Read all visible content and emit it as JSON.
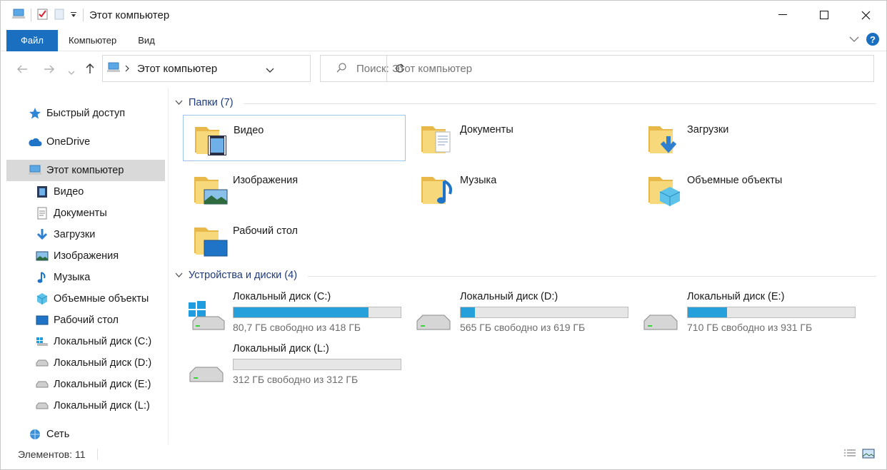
{
  "window": {
    "title": "Этот компьютер"
  },
  "ribbon": {
    "tabs": [
      "Файл",
      "Компьютер",
      "Вид"
    ]
  },
  "address": {
    "path": "Этот компьютер"
  },
  "search": {
    "placeholder": "Поиск: Этот компьютер"
  },
  "sidebar": {
    "items": [
      {
        "label": "Быстрый доступ",
        "icon": "star-icon"
      },
      {
        "label": "OneDrive",
        "icon": "cloud-icon"
      },
      {
        "label": "Этот компьютер",
        "icon": "computer-icon",
        "selected": true
      },
      {
        "label": "Видео",
        "icon": "video-icon"
      },
      {
        "label": "Документы",
        "icon": "document-icon"
      },
      {
        "label": "Загрузки",
        "icon": "download-icon"
      },
      {
        "label": "Изображения",
        "icon": "picture-icon"
      },
      {
        "label": "Музыка",
        "icon": "music-icon"
      },
      {
        "label": "Объемные объекты",
        "icon": "cube-icon"
      },
      {
        "label": "Рабочий стол",
        "icon": "desktop-icon"
      },
      {
        "label": "Локальный диск (C:)",
        "icon": "windows-drive-icon"
      },
      {
        "label": "Локальный диск (D:)",
        "icon": "drive-icon"
      },
      {
        "label": "Локальный диск (E:)",
        "icon": "drive-icon"
      },
      {
        "label": "Локальный диск (L:)",
        "icon": "drive-icon"
      },
      {
        "label": "Сеть",
        "icon": "network-icon"
      }
    ]
  },
  "folders": {
    "header": "Папки (7)",
    "items": [
      {
        "name": "Видео",
        "icon": "video-folder-icon"
      },
      {
        "name": "Документы",
        "icon": "documents-folder-icon"
      },
      {
        "name": "Загрузки",
        "icon": "downloads-folder-icon"
      },
      {
        "name": "Изображения",
        "icon": "pictures-folder-icon"
      },
      {
        "name": "Музыка",
        "icon": "music-folder-icon"
      },
      {
        "name": "Объемные объекты",
        "icon": "3d-objects-folder-icon"
      },
      {
        "name": "Рабочий стол",
        "icon": "desktop-folder-icon"
      }
    ]
  },
  "devices": {
    "header": "Устройства и диски (4)",
    "items": [
      {
        "name": "Локальный диск (C:)",
        "free": "80,7 ГБ свободно из 418 ГБ",
        "used_fraction": 0.807
      },
      {
        "name": "Локальный диск (D:)",
        "free": "565 ГБ свободно из 619 ГБ",
        "used_fraction": 0.087
      },
      {
        "name": "Локальный диск (E:)",
        "free": "710 ГБ свободно из 931 ГБ",
        "used_fraction": 0.237
      },
      {
        "name": "Локальный диск (L:)",
        "free": "312 ГБ свободно из 312 ГБ",
        "used_fraction": 0.0
      }
    ]
  },
  "status": {
    "count": "Элементов: 11"
  },
  "colors": {
    "accent": "#1a6fc0",
    "bar_fill": "#26a0da",
    "group_header": "#1e3a78"
  }
}
